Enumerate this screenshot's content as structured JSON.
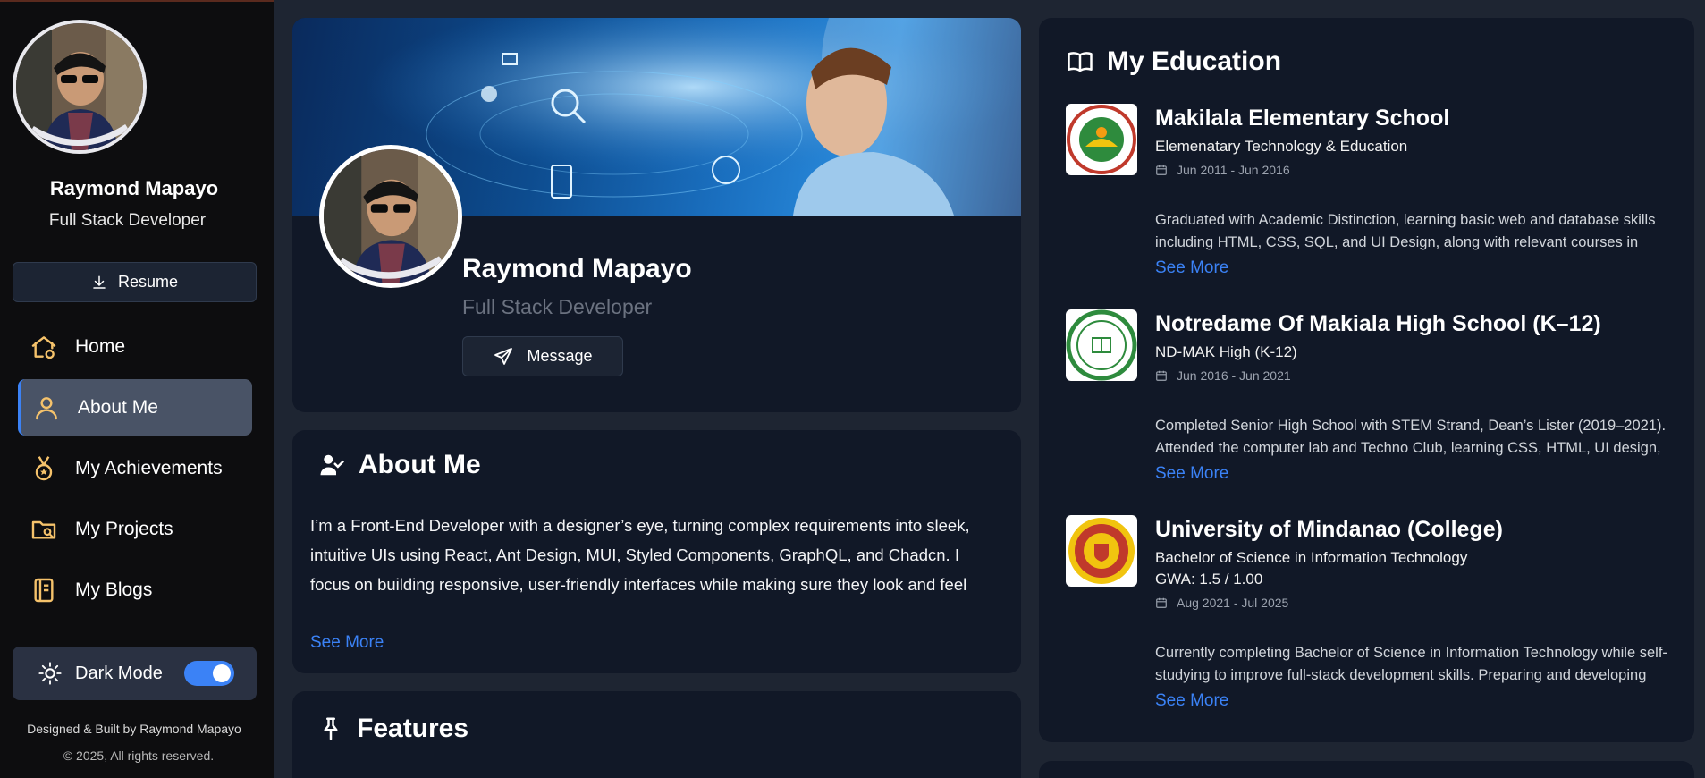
{
  "sidebar": {
    "name": "Raymond Mapayo",
    "role": "Full Stack Developer",
    "resume_label": "Resume",
    "nav": [
      {
        "label": "Home",
        "icon": "home-icon"
      },
      {
        "label": "About Me",
        "icon": "user-icon",
        "active": true
      },
      {
        "label": "My Achievements",
        "icon": "medal-icon"
      },
      {
        "label": "My Projects",
        "icon": "folder-search-icon"
      },
      {
        "label": "My Blogs",
        "icon": "notebook-icon"
      }
    ],
    "dark_mode_label": "Dark Mode",
    "dark_mode_on": true,
    "footer_line1": "Designed & Built by Raymond Mapayo",
    "footer_line2": "© 2025, All rights reserved."
  },
  "profile": {
    "name": "Raymond Mapayo",
    "role": "Full Stack Developer",
    "message_label": "Message"
  },
  "about": {
    "title": "About Me",
    "text": "I’m a Front-End Developer with a designer’s eye, turning complex requirements into sleek, intuitive UIs using React, Ant Design, MUI, Styled Components, GraphQL, and Chadcn. I focus on building responsive, user-friendly interfaces while making sure they look and feel great.",
    "see_more": "See More"
  },
  "features": {
    "title": "Features"
  },
  "education": {
    "title": "My Education",
    "items": [
      {
        "school": "Makilala Elementary School",
        "degree": "Elemenatary Technology & Education",
        "gwa": "",
        "dates": "Jun 2011 - Jun 2016",
        "description": "Graduated with Academic Distinction, learning basic web and database skills including HTML, CSS, SQL, and UI Design, along with relevant courses in Java, MySQL, and Web Design.",
        "see_more": "See More",
        "logo_colors": {
          "ring": "#c0392b",
          "center": "#2e8b3d"
        }
      },
      {
        "school": "Notredame Of Makiala High School (K–12)",
        "degree": "ND-MAK High (K-12)",
        "gwa": "",
        "dates": "Jun 2016 - Jun 2021",
        "description": "Completed Senior High School with STEM Strand, Dean’s Lister (2019–2021). Attended the computer lab and Techno Club, learning CSS, HTML, UI design, SQL, and school system design, while exploring",
        "see_more": "See More",
        "logo_colors": {
          "ring": "#2e8b3d",
          "center": "#ffffff"
        }
      },
      {
        "school": "University of Mindanao (College)",
        "degree": "Bachelor of Science in Information Technology",
        "gwa": "GWA: 1.5 / 1.00",
        "dates": "Aug 2021 - Jul 2025",
        "description": "Currently completing Bachelor of Science in Information Technology while self-studying to improve full-stack development skills. Preparing and developing capstone systems for clients using React, GraphQL",
        "see_more": "See More",
        "logo_colors": {
          "ring": "#c0392b",
          "center": "#f1c40f"
        }
      }
    ]
  },
  "colors": {
    "accent": "#3b82f6",
    "sidebar_bg": "#0d0d0f",
    "card_bg": "#111827",
    "nav_icon": "#f5c26b"
  }
}
